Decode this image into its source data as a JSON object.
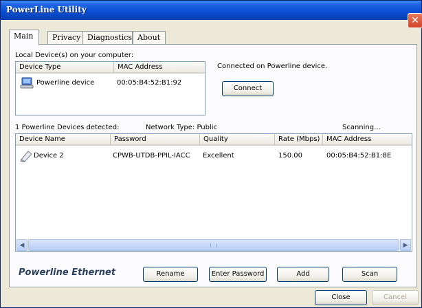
{
  "window": {
    "title": "PowerLine Utility"
  },
  "tabs": [
    "Main",
    "Privacy",
    "Diagnostics",
    "About"
  ],
  "local": {
    "heading": "Local Device(s) on your computer:",
    "columns": [
      "Device Type",
      "MAC Address"
    ],
    "row": {
      "device_type": "Powerline device",
      "mac": "00:05:B4:52:B1:92"
    },
    "status": "Connected on Powerline device.",
    "connect_label": "Connect"
  },
  "network": {
    "detected": "1 Powerline Devices detected:",
    "type": "Network Type: Public",
    "scanning": "Scanning...",
    "columns": [
      "Device Name",
      "Password",
      "Quality",
      "Rate (Mbps)",
      "MAC Address"
    ],
    "rows": [
      {
        "name": "Device 2",
        "password": "CPWB-UTDB-PPIL-IACC",
        "quality": "Excellent",
        "rate": "150.00",
        "mac": "00:05:B4:52:B1:8E"
      }
    ]
  },
  "brand": "Powerline Ethernet",
  "actions": {
    "rename": "Rename",
    "enter_password": "Enter Password",
    "add": "Add",
    "scan": "Scan"
  },
  "footer": {
    "close": "Close",
    "cancel": "Cancel"
  },
  "colors": {
    "titlebar": "#0a4fd6",
    "panel": "#fcfcfe",
    "face": "#ece9d8"
  }
}
